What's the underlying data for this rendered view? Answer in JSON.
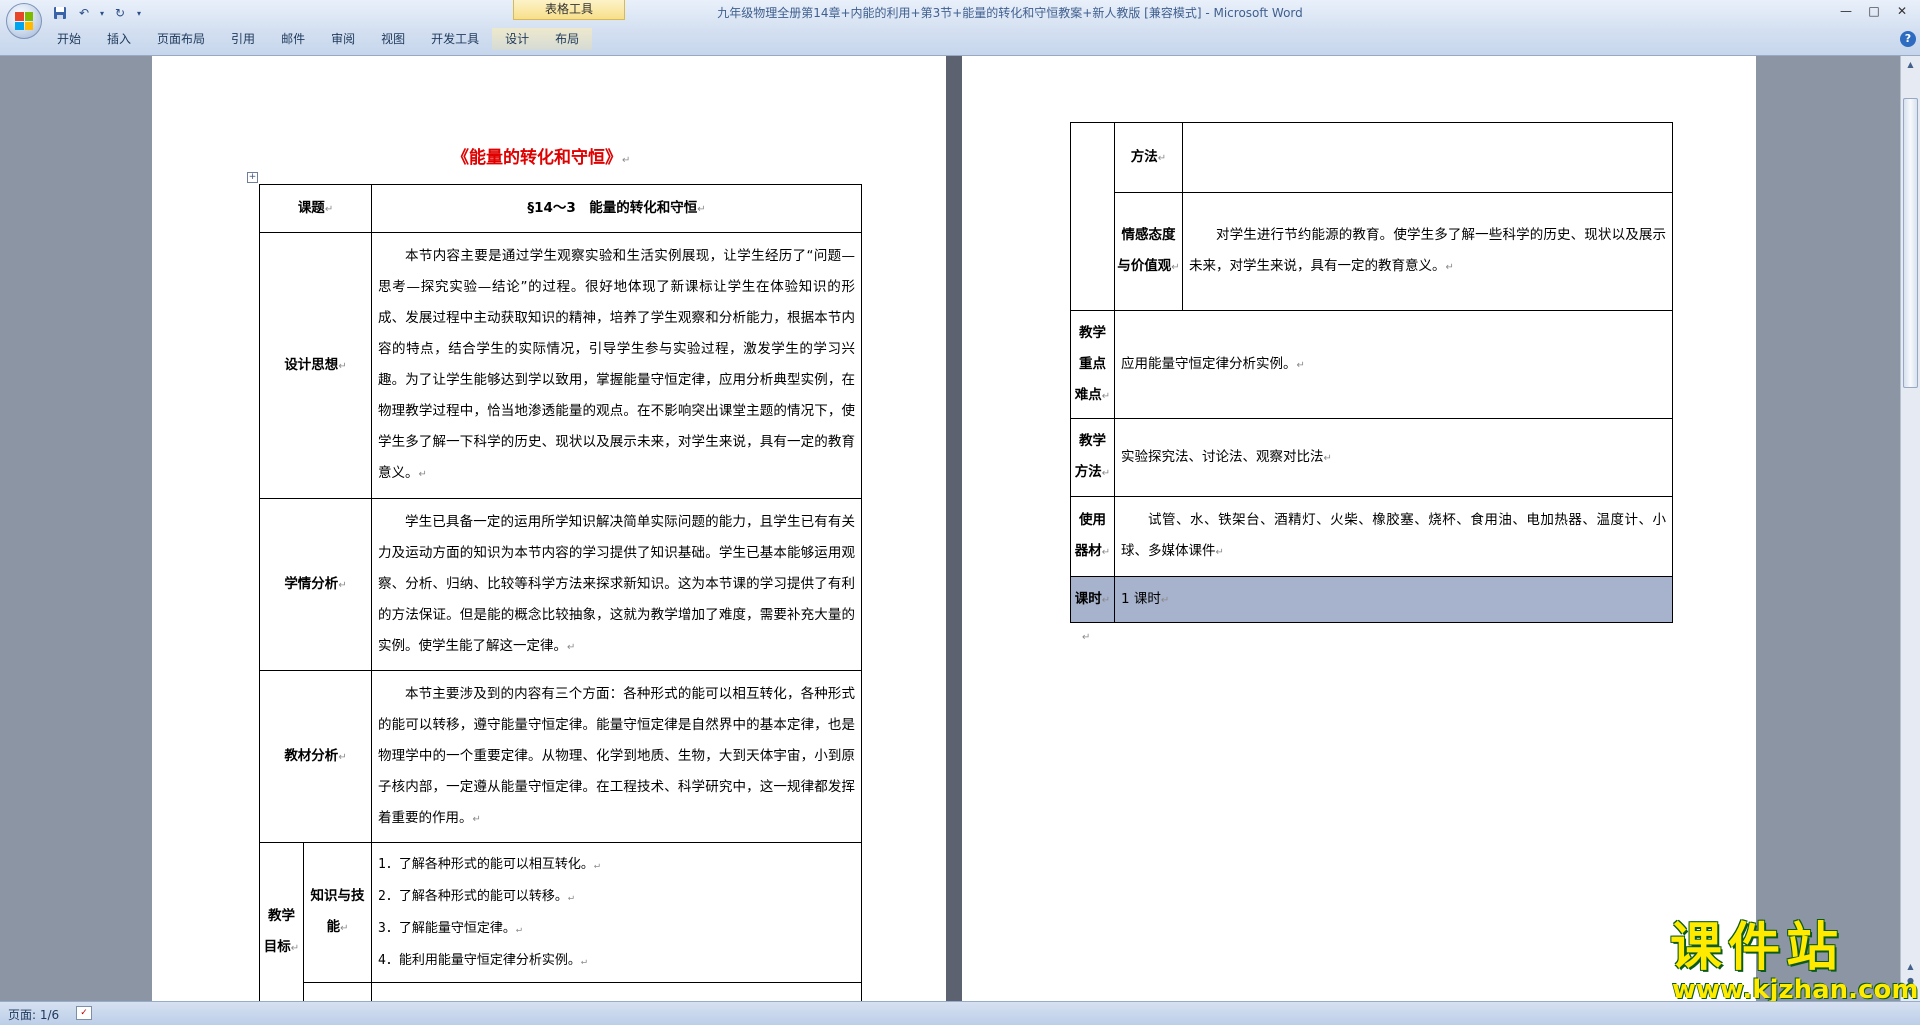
{
  "window": {
    "title": "九年级物理全册第14章+内能的利用+第3节+能量的转化和守恒教案+新人教版 [兼容模式] - Microsoft Word",
    "table_tools_label": "表格工具",
    "controls": [
      "—",
      "□",
      "✕"
    ]
  },
  "qat": {
    "save_icon": "save-icon",
    "undo_icon": "undo-icon",
    "redo_icon": "redo-icon"
  },
  "ribbon": {
    "tabs": [
      "开始",
      "插入",
      "页面布局",
      "引用",
      "邮件",
      "审阅",
      "视图",
      "开发工具",
      "设计",
      "布局"
    ]
  },
  "document": {
    "title": "《能量的转化和守恒》",
    "left_table": {
      "header_label": "课题",
      "header_value": "§14～3　能量的转化和守恒",
      "rows": [
        {
          "label": "设计思想",
          "text": "本节内容主要是通过学生观察实验和生活实例展现，让学生经历了“问题—思考—探究实验—结论”的过程。很好地体现了新课标让学生在体验知识的形成、发展过程中主动获取知识的精神，培养了学生观察和分析能力，根据本节内容的特点，结合学生的实际情况，引导学生参与实验过程，激发学生的学习兴趣。为了让学生能够达到学以致用，掌握能量守恒定律，应用分析典型实例，在物理教学过程中，恰当地渗透能量的观点。在不影响突出课堂主题的情况下，使学生多了解一下科学的历史、现状以及展示未来，对学生来说，具有一定的教育意义。"
        },
        {
          "label": "学情分析",
          "text": "学生已具备一定的运用所学知识解决简单实际问题的能力，且学生已有有关力及运动方面的知识为本节内容的学习提供了知识基础。学生已基本能够运用观察、分析、归纳、比较等科学方法来探求新知识。这为本节课的学习提供了有利的方法保证。但是能的概念比较抽象，这就为教学增加了难度，需要补充大量的实例。使学生能了解这一定律。"
        },
        {
          "label": "教材分析",
          "text": "本节主要涉及到的内容有三个方面：各种形式的能可以相互转化，各种形式的能可以转移，遵守能量守恒定律。能量守恒定律是自然界中的基本定律，也是物理学中的一个重要定律。从物理、化学到地质、生物，大到天体宇宙，小到原子核内部，一定遵从能量守恒定律。在工程技术、科学研究中，这一规律都发挥着重要的作用。"
        }
      ],
      "goals": {
        "label": "教学目标",
        "sub_label": "知识与技能",
        "items": [
          "1．了解各种形式的能可以相互转化。",
          "2．了解各种形式的能可以转移。",
          "3．了解能量守恒定律。",
          "4．能利用能量守恒定律分析实例。"
        ]
      }
    },
    "right_table": {
      "method_label": "方法",
      "emotion_label": "情感态度与价值观",
      "emotion_text": "对学生进行节约能源的教育。使学生多了解一些科学的历史、现状以及展示未来，对学生来说，具有一定的教育意义。",
      "key_label": "教学重点难点",
      "key_text": "应用能量守恒定律分析实例。",
      "teach_method_label": "教学方法",
      "teach_method_text": "实验探究法、讨论法、观察对比法",
      "equip_label": "使用器材",
      "equip_text": "试管、水、铁架台、酒精灯、火柴、橡胶塞、烧杯、食用油、电加热器、温度计、小球、多媒体课件",
      "hours_label": "课时",
      "hours_text": "1 课时"
    }
  },
  "watermark": {
    "main": "课件站",
    "url": "www.kjzhan.com"
  },
  "status": {
    "page_count": "页面: 1/6"
  }
}
